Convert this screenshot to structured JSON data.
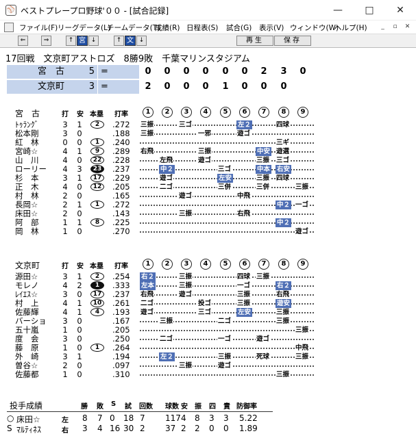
{
  "window": {
    "title": "ベストプレープロ野球'００ - [試合記録]",
    "icon": "app-icon",
    "controls": [
      "—",
      "□",
      "✕"
    ]
  },
  "menu": {
    "items": [
      "ファイル(F)",
      "リーグデータ(L)",
      "チームデータ(T)",
      "成績(R)",
      "日程表(S)",
      "試合(G)",
      "表示(V)",
      "ウィンドウ(W)",
      "ヘルプ(H)"
    ],
    "mdi_controls": [
      "_",
      "▫",
      "✕"
    ]
  },
  "toolbar": {
    "prev": "⇐",
    "next": "⇒",
    "up1": "↑",
    "team1": "宮",
    "down1": "↓",
    "up2": "↑",
    "team2": "文",
    "down2": "↓",
    "play": "再生",
    "save": "保存"
  },
  "game": {
    "header": "17回戦　文京町アストロズ　8勝9敗　千葉マリンスタジアム"
  },
  "linescore": [
    {
      "team": "宮　古",
      "score": "5",
      "innings": [
        "0",
        "0",
        "0",
        "0",
        "0",
        "0",
        "2",
        "3",
        "0"
      ]
    },
    {
      "team": "文京町",
      "score": "3",
      "innings": [
        "2",
        "0",
        "0",
        "0",
        "1",
        "0",
        "0",
        "0"
      ]
    }
  ],
  "columns": {
    "ab": "打",
    "h": "安",
    "hr": "本塁",
    "avg": "打率",
    "innings": [
      "1",
      "2",
      "3",
      "4",
      "5",
      "6",
      "7",
      "8",
      "9"
    ]
  },
  "away": {
    "name": "宮　古",
    "players": [
      {
        "name": "ﾄｩﾗﾝｸﾞ",
        "ab": "3",
        "h": "1",
        "hr": "2",
        "avg": ".272",
        "filled": false,
        "results": [
          {
            "i": 0,
            "t": "三振",
            "hl": false
          },
          {
            "i": 2,
            "t": "三ゴ",
            "hl": false
          },
          {
            "i": 5,
            "t": "左２",
            "hl": true
          },
          {
            "i": 7,
            "t": "四球",
            "hl": false
          }
        ]
      },
      {
        "name": "松本剛",
        "ab": "3",
        "h": "0",
        "hr": "",
        "avg": ".188",
        "filled": false,
        "results": [
          {
            "i": 0,
            "t": "三振",
            "hl": false
          },
          {
            "i": 3,
            "t": "一邪",
            "hl": false
          },
          {
            "i": 5,
            "t": "遊ゴ",
            "hl": false
          }
        ]
      },
      {
        "name": "紅　林",
        "ab": "0",
        "h": "0",
        "hr": "1",
        "avg": ".240",
        "filled": false,
        "results": [
          {
            "i": 7,
            "t": "三ギ",
            "hl": false
          }
        ]
      },
      {
        "name": "宮崎☆",
        "ab": "4",
        "h": "1",
        "hr": "9",
        "avg": ".289",
        "filled": false,
        "results": [
          {
            "i": 0,
            "t": "右飛",
            "hl": false
          },
          {
            "i": 3,
            "t": "三振",
            "hl": false
          },
          {
            "i": 6,
            "t": "中安",
            "hl": true
          },
          {
            "i": 7,
            "t": "遊選",
            "hl": false
          }
        ]
      },
      {
        "name": "山　川",
        "ab": "4",
        "h": "0",
        "hr": "22",
        "avg": ".228",
        "filled": false,
        "results": [
          {
            "i": 1,
            "t": "左飛",
            "hl": false
          },
          {
            "i": 3,
            "t": "遊ゴ",
            "hl": false
          },
          {
            "i": 6,
            "t": "三振",
            "hl": false
          },
          {
            "i": 7,
            "t": "三ゴ",
            "hl": false
          }
        ]
      },
      {
        "name": "ローリー",
        "ab": "4",
        "h": "3",
        "hr": "23",
        "avg": ".237",
        "filled": true,
        "results": [
          {
            "i": 1,
            "t": "中２",
            "hl": true
          },
          {
            "i": 4,
            "t": "三ゴ",
            "hl": false
          },
          {
            "i": 6,
            "t": "中本",
            "hl": true
          },
          {
            "i": 7,
            "t": "右安",
            "hl": true
          }
        ]
      },
      {
        "name": "杉　本",
        "ab": "3",
        "h": "1",
        "hr": "17",
        "avg": ".229",
        "filled": false,
        "results": [
          {
            "i": 1,
            "t": "遊ゴ",
            "hl": false
          },
          {
            "i": 4,
            "t": "左安",
            "hl": true
          },
          {
            "i": 6,
            "t": "三振",
            "hl": false
          },
          {
            "i": 7,
            "t": "四球",
            "hl": false
          }
        ]
      },
      {
        "name": "正　木",
        "ab": "4",
        "h": "0",
        "hr": "12",
        "avg": ".205",
        "filled": false,
        "results": [
          {
            "i": 1,
            "t": "二ゴ",
            "hl": false
          },
          {
            "i": 4,
            "t": "三併",
            "hl": false
          },
          {
            "i": 6,
            "t": "三併",
            "hl": false
          },
          {
            "i": 8,
            "t": "三振",
            "hl": false
          }
        ]
      },
      {
        "name": "村　林",
        "ab": "2",
        "h": "0",
        "hr": "",
        "avg": ".165",
        "filled": false,
        "results": [
          {
            "i": 2,
            "t": "遊ゴ",
            "hl": false
          },
          {
            "i": 5,
            "t": "中飛",
            "hl": false
          }
        ]
      },
      {
        "name": "長岡☆",
        "ab": "2",
        "h": "1",
        "hr": "1",
        "avg": ".272",
        "filled": false,
        "results": [
          {
            "i": 7,
            "t": "中２",
            "hl": true
          },
          {
            "i": 8,
            "t": "一ゴ",
            "hl": false
          }
        ]
      },
      {
        "name": "床田☆",
        "ab": "2",
        "h": "0",
        "hr": "",
        "avg": ".143",
        "filled": false,
        "results": [
          {
            "i": 2,
            "t": "三振",
            "hl": false
          },
          {
            "i": 5,
            "t": "右飛",
            "hl": false
          }
        ]
      },
      {
        "name": "阿　部",
        "ab": "1",
        "h": "1",
        "hr": "8",
        "avg": ".225",
        "filled": false,
        "results": [
          {
            "i": 7,
            "t": "中２",
            "hl": true
          }
        ]
      },
      {
        "name": "岡　林",
        "ab": "1",
        "h": "0",
        "hr": "",
        "avg": ".270",
        "filled": false,
        "results": [
          {
            "i": 8,
            "t": "遊ゴ",
            "hl": false
          }
        ]
      }
    ]
  },
  "home": {
    "name": "文京町",
    "players": [
      {
        "name": "源田☆",
        "ab": "3",
        "h": "1",
        "hr": "2",
        "avg": ".254",
        "filled": false,
        "results": [
          {
            "i": 0,
            "t": "右２",
            "hl": true
          },
          {
            "i": 2,
            "t": "三振",
            "hl": false
          },
          {
            "i": 5,
            "t": "四球",
            "hl": false
          },
          {
            "i": 6,
            "t": "三振",
            "hl": false
          }
        ]
      },
      {
        "name": "モレノ",
        "ab": "4",
        "h": "2",
        "hr": "1",
        "avg": ".333",
        "filled": true,
        "results": [
          {
            "i": 0,
            "t": "左本",
            "hl": true
          },
          {
            "i": 2,
            "t": "三振",
            "hl": false
          },
          {
            "i": 5,
            "t": "一ゴ",
            "hl": false
          },
          {
            "i": 7,
            "t": "右２",
            "hl": true
          }
        ]
      },
      {
        "name": "ﾚｲｴｽ☆",
        "ab": "3",
        "h": "0",
        "hr": "17",
        "avg": ".237",
        "filled": false,
        "results": [
          {
            "i": 0,
            "t": "右飛",
            "hl": false
          },
          {
            "i": 2,
            "t": "遊ゴ",
            "hl": false
          },
          {
            "i": 5,
            "t": "三振",
            "hl": false
          },
          {
            "i": 7,
            "t": "右飛",
            "hl": false
          }
        ]
      },
      {
        "name": "村　上",
        "ab": "4",
        "h": "1",
        "hr": "10",
        "avg": ".261",
        "filled": false,
        "results": [
          {
            "i": 0,
            "t": "二ゴ",
            "hl": false
          },
          {
            "i": 3,
            "t": "投ゴ",
            "hl": false
          },
          {
            "i": 5,
            "t": "三振",
            "hl": false
          },
          {
            "i": 7,
            "t": "遊安",
            "hl": true
          }
        ]
      },
      {
        "name": "佐藤輝",
        "ab": "4",
        "h": "1",
        "hr": "4",
        "avg": ".193",
        "filled": false,
        "results": [
          {
            "i": 0,
            "t": "遊ゴ",
            "hl": false
          },
          {
            "i": 3,
            "t": "三ゴ",
            "hl": false
          },
          {
            "i": 5,
            "t": "左安",
            "hl": true
          },
          {
            "i": 7,
            "t": "三振",
            "hl": false
          }
        ]
      },
      {
        "name": "バーショ",
        "ab": "3",
        "h": "0",
        "hr": "",
        "avg": ".167",
        "filled": false,
        "results": [
          {
            "i": 1,
            "t": "三振",
            "hl": false
          },
          {
            "i": 4,
            "t": "二ゴ",
            "hl": false
          },
          {
            "i": 7,
            "t": "三振",
            "hl": false
          }
        ]
      },
      {
        "name": "五十嵐",
        "ab": "1",
        "h": "0",
        "hr": "",
        "avg": ".205",
        "filled": false,
        "results": [
          {
            "i": 8,
            "t": "三振",
            "hl": false
          }
        ]
      },
      {
        "name": "度　会",
        "ab": "3",
        "h": "0",
        "hr": "",
        "avg": ".250",
        "filled": false,
        "results": [
          {
            "i": 1,
            "t": "二ゴ",
            "hl": false
          },
          {
            "i": 4,
            "t": "一ゴ",
            "hl": false
          },
          {
            "i": 6,
            "t": "遊ゴ",
            "hl": false
          }
        ]
      },
      {
        "name": "藤　原",
        "ab": "1",
        "h": "0",
        "hr": "1",
        "avg": ".264",
        "filled": false,
        "results": [
          {
            "i": 8,
            "t": "中飛",
            "hl": false
          }
        ]
      },
      {
        "name": "外　崎",
        "ab": "3",
        "h": "1",
        "hr": "",
        "avg": ".194",
        "filled": false,
        "results": [
          {
            "i": 1,
            "t": "左２",
            "hl": true
          },
          {
            "i": 4,
            "t": "三振",
            "hl": false
          },
          {
            "i": 6,
            "t": "死球",
            "hl": false
          },
          {
            "i": 8,
            "t": "三振",
            "hl": false
          }
        ]
      },
      {
        "name": "曽谷☆",
        "ab": "2",
        "h": "0",
        "hr": "",
        "avg": ".097",
        "filled": false,
        "results": [
          {
            "i": 2,
            "t": "三振",
            "hl": false
          },
          {
            "i": 4,
            "t": "遊ゴ",
            "hl": false
          }
        ]
      },
      {
        "name": "佐藤都",
        "ab": "1",
        "h": "0",
        "hr": "",
        "avg": ".310",
        "filled": false,
        "results": [
          {
            "i": 7,
            "t": "三振",
            "hl": false
          }
        ]
      }
    ]
  },
  "pitching": {
    "title": "投手成績",
    "headers": [
      "勝",
      "敗",
      "S",
      "試",
      "回数",
      "球数",
      "安",
      "振",
      "四",
      "責",
      "防御率"
    ],
    "rows": [
      {
        "mark": "○",
        "name": "床田☆",
        "hand": "左",
        "w": "8",
        "l": "7",
        "s": "0",
        "g": "18",
        "ip": "7",
        "pitches": "117",
        "h": "4",
        "k": "8",
        "bb": "3",
        "er": "3",
        "era": "5.22"
      },
      {
        "mark": "S",
        "name": "ﾏﾙﾃｨﾈｽ",
        "hand": "右",
        "w": "3",
        "l": "4",
        "s": "16",
        "g": "30",
        "ip": "2",
        "pitches": "37",
        "h": "2",
        "k": "2",
        "bb": "0",
        "er": "0",
        "era": "1.89"
      }
    ]
  }
}
